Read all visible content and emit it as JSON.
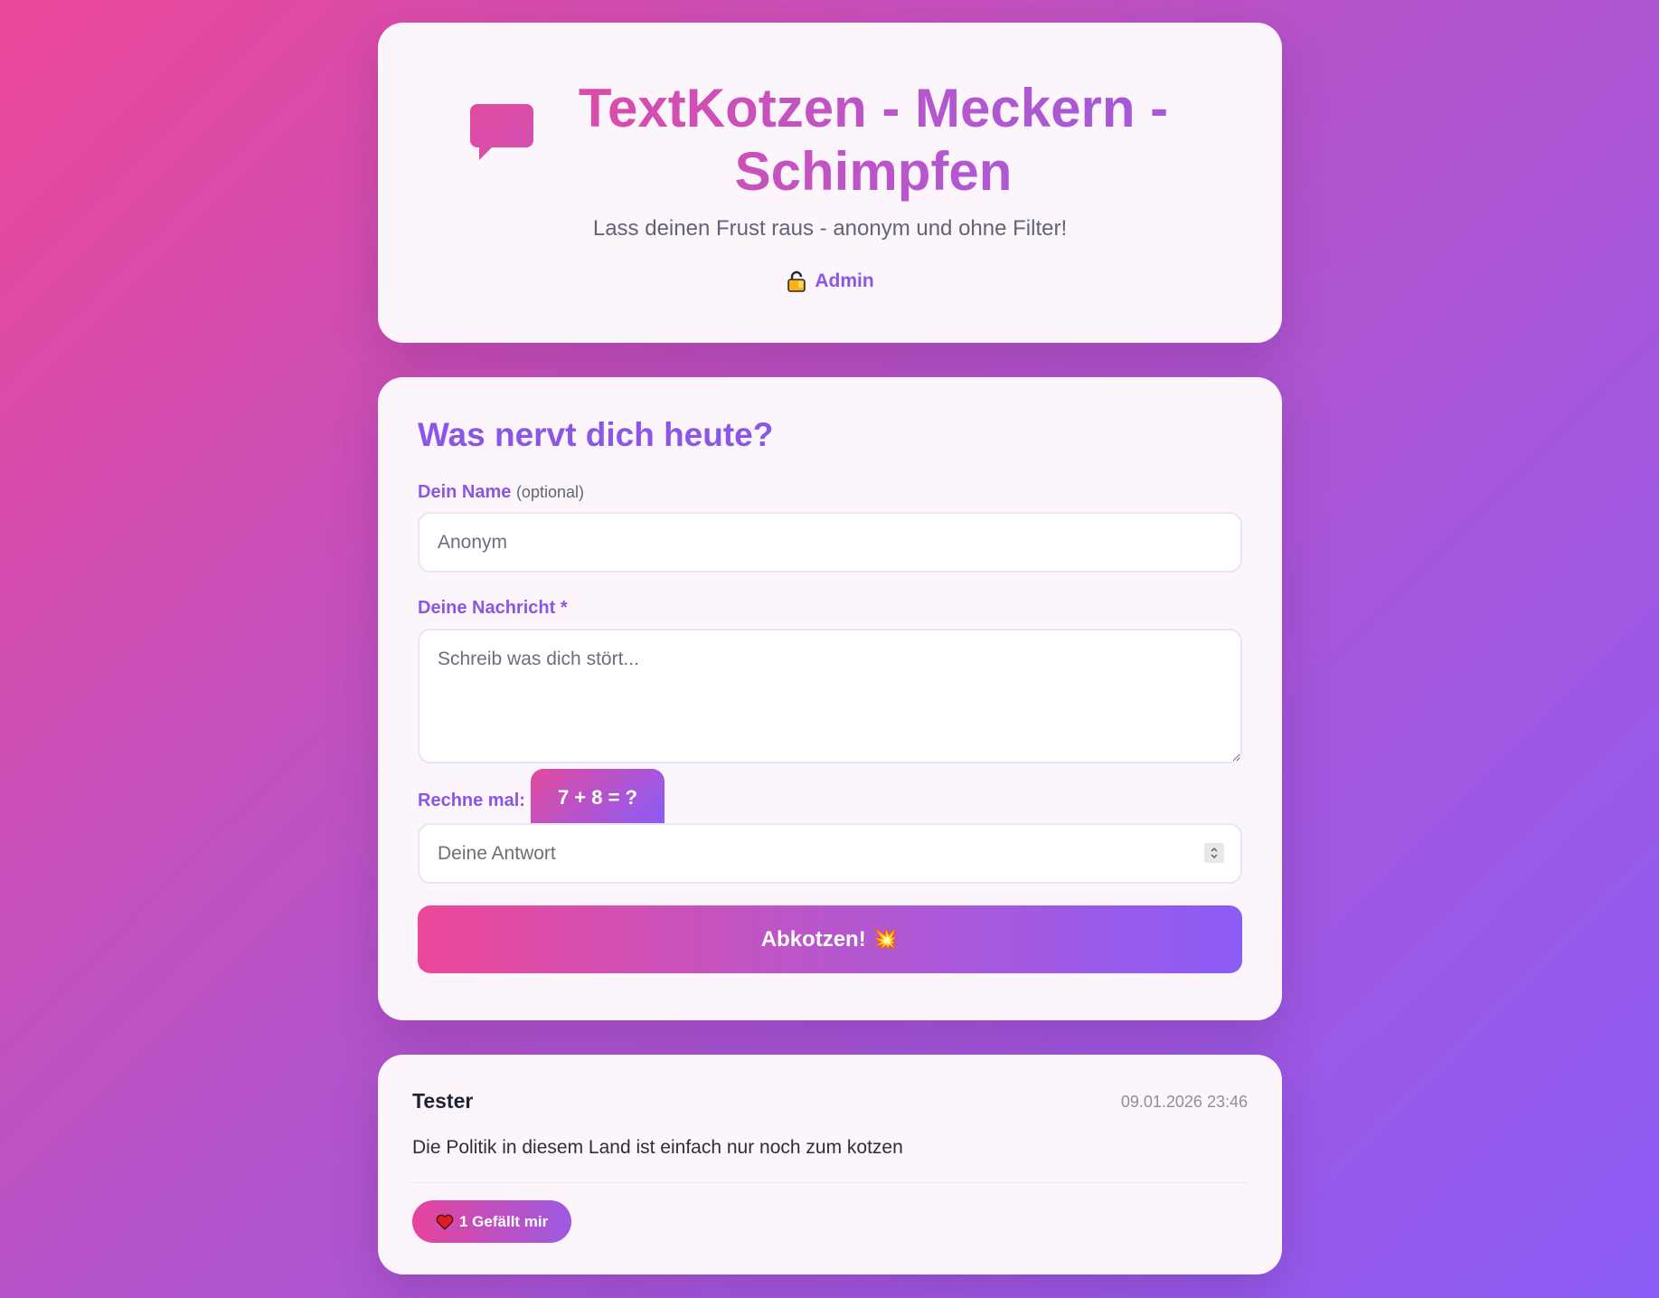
{
  "header": {
    "title": "TextKotzen - Meckern - Schimpfen",
    "subtitle": "Lass deinen Frust raus - anonym und ohne Filter!",
    "admin_label": "Admin",
    "title_icon": "speech-bubble-icon",
    "admin_icon": "lock-icon"
  },
  "form": {
    "title": "Was nervt dich heute?",
    "name_label": "Dein Name",
    "name_optional": "(optional)",
    "name_placeholder": "Anonym",
    "message_label": "Deine Nachricht *",
    "message_placeholder": "Schreib was dich stört...",
    "captcha_label": "Rechne mal:",
    "captcha_question": "7 + 8 = ?",
    "answer_placeholder": "Deine Antwort",
    "submit_label": "Abkotzen! 💥"
  },
  "posts": [
    {
      "author": "Tester",
      "date": "09.01.2026 23:46",
      "text": "Die Politik in diesem Land ist einfach nur noch zum kotzen",
      "like_label": "1 Gefällt mir",
      "like_icon": "heart-icon"
    }
  ],
  "colors": {
    "accent": "#8b56e6",
    "pink": "#ec4899",
    "violet": "#8b5cf6"
  }
}
